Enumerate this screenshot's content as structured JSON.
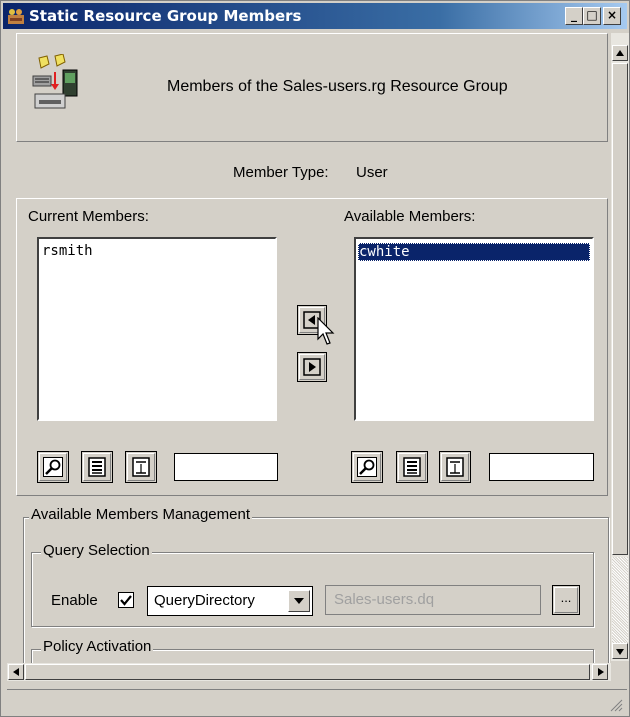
{
  "window": {
    "title": "Static Resource Group Members",
    "controls": {
      "minimize": "_",
      "maximize": "□",
      "close": "×"
    }
  },
  "header": {
    "heading": "Members of the Sales-users.rg Resource Group"
  },
  "member_type": {
    "label": "Member Type:",
    "value": "User"
  },
  "current_members": {
    "label": "Current Members:",
    "items": [
      "rsmith"
    ],
    "filter_value": ""
  },
  "available_members": {
    "label": "Available Members:",
    "items": [
      "cwhite"
    ],
    "selected": "cwhite",
    "filter_value": ""
  },
  "management": {
    "legend": "Available Members Management",
    "query_selection": {
      "legend": "Query Selection",
      "enable_label": "Enable",
      "enabled": true,
      "query_type": "QueryDirectory",
      "query_file": "Sales-users.dq",
      "browse_label": "..."
    },
    "policy_activation": {
      "legend": "Policy Activation"
    }
  },
  "colors": {
    "title_bar": "#0a246a",
    "selection": "#0a246a",
    "window_bg": "#d4d0c8"
  }
}
